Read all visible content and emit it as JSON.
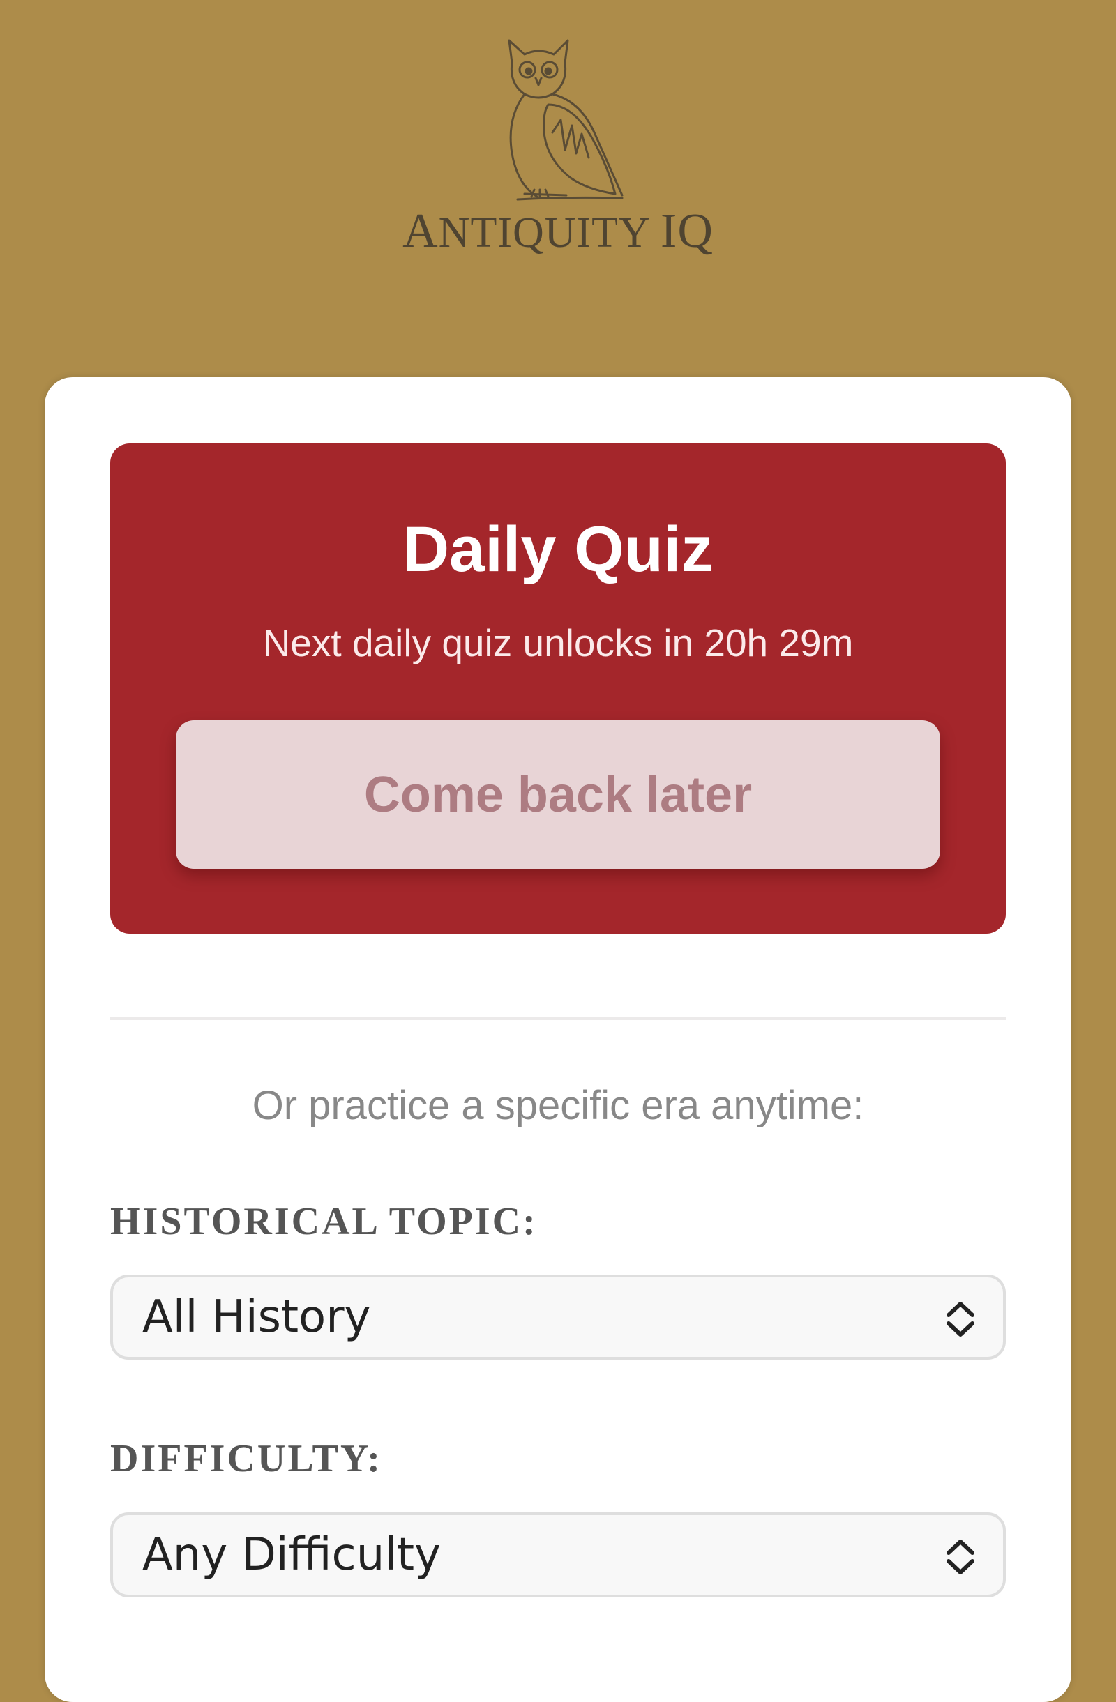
{
  "brand": {
    "name_prefix": "A",
    "name_rest": "NTIQUITY ",
    "name_iq_i": "I",
    "name_iq_q": "Q",
    "logo_icon": "owl-icon"
  },
  "daily_quiz": {
    "title": "Daily Quiz",
    "countdown_text": "Next daily quiz unlocks in 20h 29m",
    "button_label": "Come back later"
  },
  "practice": {
    "prompt": "Or practice a specific era anytime:"
  },
  "topic": {
    "label": "HISTORICAL TOPIC:",
    "selected": "All History"
  },
  "difficulty": {
    "label": "DIFFICULTY:",
    "selected": "Any Difficulty"
  },
  "colors": {
    "background": "#ad8c4a",
    "card": "#ffffff",
    "daily_panel": "#a4262b",
    "disabled_button": "#e8d4d6"
  }
}
